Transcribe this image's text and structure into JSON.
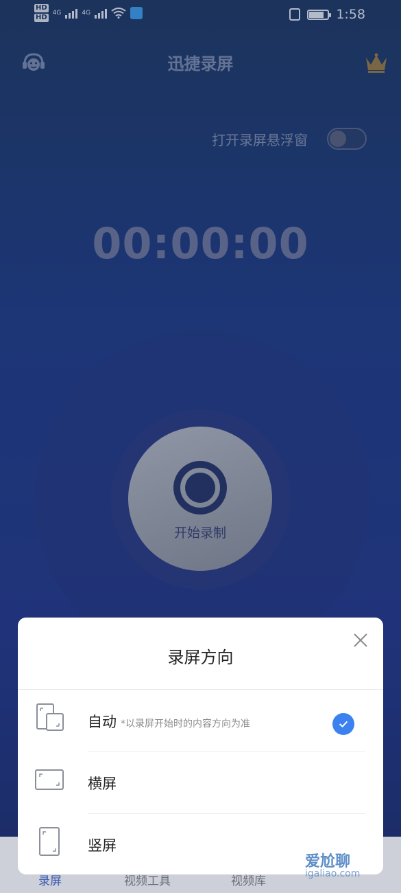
{
  "status_bar": {
    "network_badges": [
      "HD",
      "HD"
    ],
    "signal_labels": [
      "4G",
      "4G"
    ],
    "time": "1:58",
    "battery_level": 0.8
  },
  "header": {
    "title": "迅捷录屏",
    "left_icon": "support-headset-icon",
    "right_icon": "crown-icon"
  },
  "float_window": {
    "label": "打开录屏悬浮窗",
    "enabled": false
  },
  "timer": "00:00:00",
  "record_button": {
    "label": "开始录制"
  },
  "tab_bar": {
    "tabs": [
      "录屏",
      "视频工具",
      "视频库"
    ]
  },
  "orientation_sheet": {
    "title": "录屏方向",
    "options": [
      {
        "label": "自动",
        "hint": "*以录屏开始时的内容方向为准",
        "selected": true
      },
      {
        "label": "横屏",
        "hint": "",
        "selected": false
      },
      {
        "label": "竖屏",
        "hint": "",
        "selected": false
      }
    ]
  },
  "watermark": {
    "text": "爱尬聊",
    "url": "igaliao.com"
  },
  "colors": {
    "accent": "#3b82f0",
    "background_top": "#1f3a66",
    "background_bottom": "#1d2f73"
  }
}
